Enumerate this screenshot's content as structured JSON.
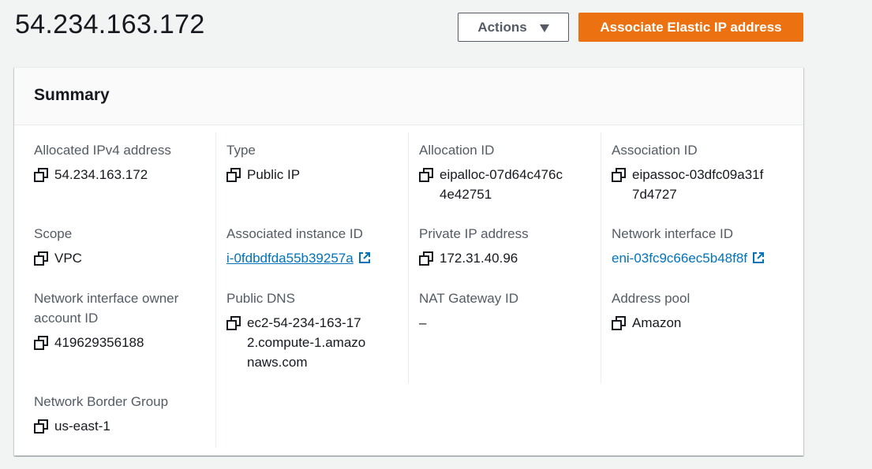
{
  "page": {
    "title": "54.234.163.172",
    "actions_label": "Actions",
    "primary_label": "Associate Elastic IP address"
  },
  "summary": {
    "title": "Summary",
    "allocated_ipv4": {
      "label": "Allocated IPv4 address",
      "value": "54.234.163.172"
    },
    "type": {
      "label": "Type",
      "value": "Public IP"
    },
    "allocation_id": {
      "label": "Allocation ID",
      "value": "eipalloc-07d64c476c4e42751"
    },
    "association_id": {
      "label": "Association ID",
      "value": "eipassoc-03dfc09a31f7d4727"
    },
    "scope": {
      "label": "Scope",
      "value": "VPC"
    },
    "instance_id": {
      "label": "Associated instance ID",
      "value": "i-0fdbdfda55b39257a"
    },
    "private_ip": {
      "label": "Private IP address",
      "value": "172.31.40.96"
    },
    "eni_id": {
      "label": "Network interface ID",
      "value": "eni-03fc9c66ec5b48f8f"
    },
    "eni_owner": {
      "label": "Network interface owner account ID",
      "value": "419629356188"
    },
    "public_dns": {
      "label": "Public DNS",
      "value": "ec2-54-234-163-172.compute-1.amazonaws.com"
    },
    "nat_gateway": {
      "label": "NAT Gateway ID",
      "value": "–"
    },
    "address_pool": {
      "label": "Address pool",
      "value": "Amazon"
    },
    "border_group": {
      "label": "Network Border Group",
      "value": "us-east-1"
    }
  },
  "colors": {
    "accent": "#ec7211",
    "link": "#0073bb",
    "label": "#545b64"
  }
}
